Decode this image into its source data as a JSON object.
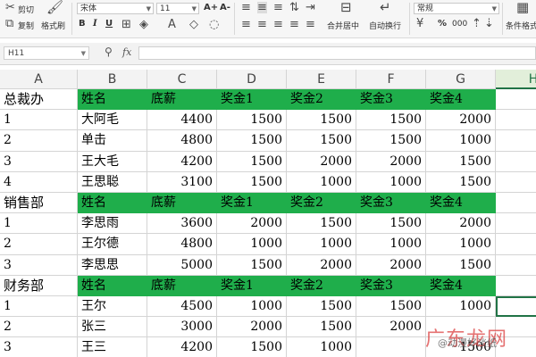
{
  "toolbar": {
    "cut": "剪切",
    "copy": "复制",
    "format_painter": "格式刷",
    "font_name": "宋体",
    "font_size": "11",
    "merge_center": "合并居中",
    "wrap_text": "自动换行",
    "number_format": "常规",
    "conditional_format": "条件格式",
    "bold": "B",
    "italic": "I",
    "underline": "U",
    "font_grow": "A+",
    "font_shrink": "A-",
    "percent": "%",
    "thousands": "000"
  },
  "formula_bar": {
    "name_box": "H11",
    "fx": "fx",
    "formula": ""
  },
  "columns": [
    "A",
    "B",
    "C",
    "D",
    "E",
    "F",
    "G",
    "H"
  ],
  "selected_column": "H",
  "rows": [
    [
      "总裁办",
      "姓名",
      "底薪",
      "奖金1",
      "奖金2",
      "奖金3",
      "奖金4"
    ],
    [
      "1",
      "大阿毛",
      "4400",
      "1500",
      "1500",
      "1500",
      "2000"
    ],
    [
      "2",
      "单击",
      "4800",
      "1500",
      "1500",
      "1500",
      "1000"
    ],
    [
      "3",
      "王大毛",
      "4200",
      "1500",
      "2000",
      "2000",
      "1500"
    ],
    [
      "4",
      "王思聪",
      "3100",
      "1500",
      "1000",
      "1000",
      "1500"
    ],
    [
      "销售部",
      "姓名",
      "底薪",
      "奖金1",
      "奖金2",
      "奖金3",
      "奖金4"
    ],
    [
      "1",
      "李思雨",
      "3600",
      "2000",
      "1500",
      "1500",
      "2000"
    ],
    [
      "2",
      "王尔德",
      "4800",
      "1000",
      "1000",
      "1000",
      "1000"
    ],
    [
      "3",
      "李思思",
      "5000",
      "1500",
      "2000",
      "2000",
      "1500"
    ],
    [
      "财务部",
      "姓名",
      "底薪",
      "奖金1",
      "奖金2",
      "奖金3",
      "奖金4"
    ],
    [
      "1",
      "王尔",
      "4500",
      "1000",
      "1500",
      "1500",
      "1000"
    ],
    [
      "2",
      "张三",
      "3000",
      "2000",
      "1500",
      "2000",
      ""
    ],
    [
      "3",
      "王三",
      "4200",
      "1500",
      "1000",
      "",
      "1500"
    ]
  ],
  "header_rows": [
    0,
    5,
    9
  ],
  "colors": {
    "header_fill": "#1fae4b",
    "selection": "#217346"
  },
  "watermark": {
    "logo": "广东龙网",
    "text": "@动漫好淡纸"
  }
}
